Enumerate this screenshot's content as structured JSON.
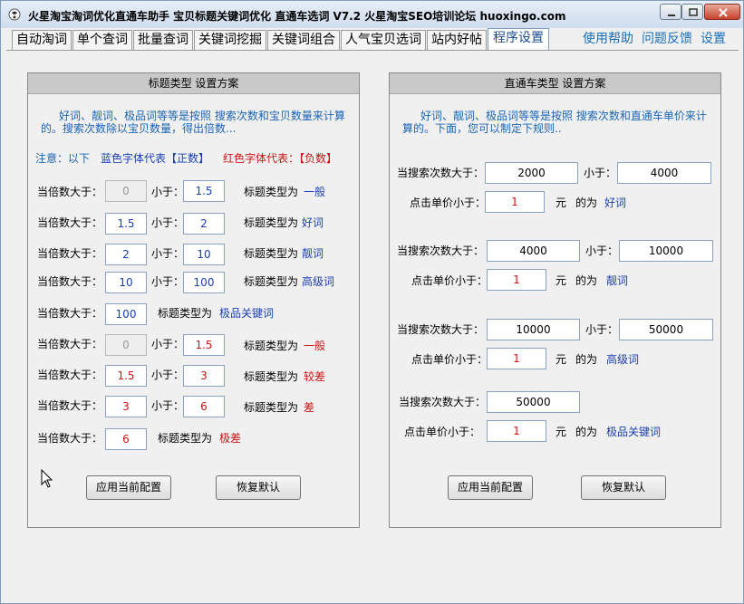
{
  "window": {
    "title": "火星淘宝淘词优化直通车助手 宝贝标题关键词优化 直通车选词 V7.2 火星淘宝SEO培训论坛 huoxingo.com"
  },
  "tabs": [
    "自动淘词",
    "单个查词",
    "批量查词",
    "关键词挖掘",
    "关键词组合",
    "人气宝贝选词",
    "站内好帖",
    "程序设置"
  ],
  "active_tab": "程序设置",
  "top_links": [
    "使用帮助",
    "问题反馈",
    "设置"
  ],
  "left_panel": {
    "title": "标题类型 设置方案",
    "description": "好词、靓词、极品词等等是按照 搜索次数和宝贝数量来计算的。搜索次数除以宝贝数量，得出倍数...",
    "note_prefix": "注意：以下",
    "note_blue": "蓝色字体代表【正数】",
    "note_red": "红色字体代表：【负数】",
    "gt_label": "当倍数大于：",
    "lt_label": "小于：",
    "type_label": "标题类型为",
    "rows": [
      {
        "min": "0",
        "max": "1.5",
        "type": "一般",
        "color": "blue",
        "min_disabled": true
      },
      {
        "min": "1.5",
        "max": "2",
        "type": "好词",
        "color": "blue",
        "min_disabled": false
      },
      {
        "min": "2",
        "max": "10",
        "type": "靓词",
        "color": "blue",
        "min_disabled": false
      },
      {
        "min": "10",
        "max": "100",
        "type": "高级词",
        "color": "blue",
        "min_disabled": false
      },
      {
        "min": "100",
        "type": "极品关键词",
        "color": "blue",
        "min_disabled": false
      },
      {
        "min": "0",
        "max": "1.5",
        "type": "一般",
        "color": "red",
        "min_disabled": true
      },
      {
        "min": "1.5",
        "max": "3",
        "type": "较差",
        "color": "red",
        "min_disabled": false
      },
      {
        "min": "3",
        "max": "6",
        "type": "差",
        "color": "red",
        "min_disabled": false
      },
      {
        "min": "6",
        "type": "极差",
        "color": "red",
        "min_disabled": false
      }
    ],
    "apply_button": "应用当前配置",
    "reset_button": "恢复默认"
  },
  "right_panel": {
    "title": "直通车类型 设置方案",
    "description": "好词、靓词、极品词等等是按照 搜索次数和直通车单价来计算的。下面，您可以制定下规则..",
    "search_gt_label": "当搜索次数大于：",
    "lt_label": "小于：",
    "price_lt_label": "点击单价小于：",
    "unit": "元",
    "as_label": "的为",
    "groups": [
      {
        "search_min": "2000",
        "search_max": "4000",
        "price_max": "1",
        "type": "好词"
      },
      {
        "search_min": "4000",
        "search_max": "10000",
        "price_max": "1",
        "type": "靓词"
      },
      {
        "search_min": "10000",
        "search_max": "50000",
        "price_max": "1",
        "type": "高级词"
      },
      {
        "search_min": "50000",
        "price_max": "1",
        "type": "极品关键词"
      }
    ],
    "apply_button": "应用当前配置",
    "reset_button": "恢复默认"
  },
  "icons": [
    "app-icon",
    "minimize-icon",
    "maximize-icon",
    "close-icon",
    "mouse-cursor-icon"
  ],
  "colors": {
    "accent": "#1a64b5",
    "positive": "#1a3fb0",
    "negative": "#c81414",
    "panel_header": "#c9c9c9"
  }
}
